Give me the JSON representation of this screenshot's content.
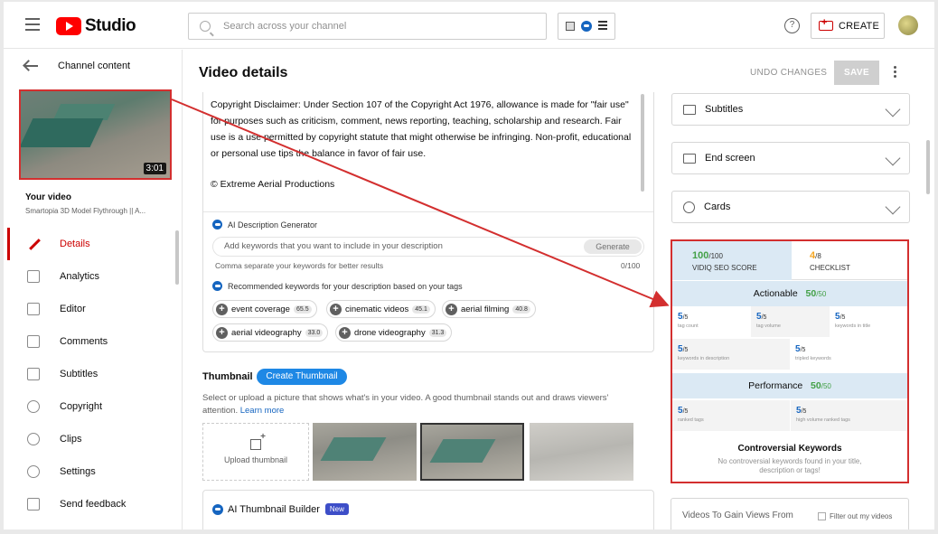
{
  "header": {
    "logo_text": "Studio",
    "search_placeholder": "Search across your channel",
    "create_label": "CREATE",
    "help_glyph": "?"
  },
  "sidebar": {
    "back_label": "Channel content",
    "video_duration": "3:01",
    "your_video_label": "Your video",
    "video_title": "Smartopia 3D Model Flythrough || A...",
    "items": [
      {
        "label": "Details",
        "icon": "pencil-icon",
        "active": true
      },
      {
        "label": "Analytics",
        "icon": "analytics-icon"
      },
      {
        "label": "Editor",
        "icon": "editor-icon"
      },
      {
        "label": "Comments",
        "icon": "comments-icon"
      },
      {
        "label": "Subtitles",
        "icon": "subtitles-icon"
      },
      {
        "label": "Copyright",
        "icon": "copyright-icon"
      },
      {
        "label": "Clips",
        "icon": "scissors-icon"
      },
      {
        "label": "Settings",
        "icon": "gear-icon"
      },
      {
        "label": "Send feedback",
        "icon": "feedback-icon"
      }
    ]
  },
  "main": {
    "title": "Video details",
    "undo_label": "UNDO CHANGES",
    "save_label": "SAVE",
    "description": {
      "text": "Copyright Disclaimer: Under Section 107 of the Copyright Act 1976, allowance is made for \"fair use\" for purposes such as criticism, comment, news reporting, teaching, scholarship and research. Fair use is a use permitted by copyright statute that might otherwise be infringing. Non-profit, educational or personal use tips the balance in favor of fair use.",
      "copyright_line": "© Extreme Aerial Productions"
    },
    "ai_description": {
      "title": "AI Description Generator",
      "placeholder": "Add keywords that you want to include in your description",
      "generate_label": "Generate",
      "help_text": "Comma separate your keywords for better results",
      "count": "0/100",
      "recommended_title": "Recommended keywords for your description based on your tags",
      "chips": [
        {
          "label": "event coverage",
          "score": "65.5"
        },
        {
          "label": "cinematic videos",
          "score": "45.1"
        },
        {
          "label": "aerial filming",
          "score": "40.8"
        },
        {
          "label": "aerial videography",
          "score": "33.0"
        },
        {
          "label": "drone videography",
          "score": "31.3"
        }
      ]
    },
    "thumbnail": {
      "title": "Thumbnail",
      "create_label": "Create Thumbnail",
      "description": "Select or upload a picture that shows what's in your video. A good thumbnail stands out and draws viewers' attention.",
      "learn_more": "Learn more",
      "upload_label": "Upload thumbnail"
    },
    "ai_thumbnail": {
      "title": "AI Thumbnail Builder",
      "badge": "New"
    }
  },
  "right": {
    "cards": [
      {
        "label": "Subtitles",
        "icon": "subtitles-icon"
      },
      {
        "label": "End screen",
        "icon": "end-screen-icon"
      },
      {
        "label": "Cards",
        "icon": "info-icon"
      }
    ],
    "vidiq": {
      "seo_score": "100",
      "seo_max": "/100",
      "seo_label": "VIDIQ SEO SCORE",
      "checklist_score": "4",
      "checklist_max": "/8",
      "checklist_label": "CHECKLIST",
      "actionable_label": "Actionable",
      "actionable_score": "50",
      "actionable_max": "/50",
      "actionable_cells": [
        {
          "value": "5",
          "max": "/5",
          "label": "tag count"
        },
        {
          "value": "5",
          "max": "/5",
          "label": "tag volume"
        },
        {
          "value": "5",
          "max": "/5",
          "label": "keywords in title"
        },
        {
          "value": "5",
          "max": "/5",
          "label": "keywords in description"
        },
        {
          "value": "5",
          "max": "/5",
          "label": "tripled keywords"
        }
      ],
      "performance_label": "Performance",
      "performance_score": "50",
      "performance_max": "/50",
      "performance_cells": [
        {
          "value": "5",
          "max": "/5",
          "label": "ranked tags"
        },
        {
          "value": "5",
          "max": "/5",
          "label": "high volume ranked tags"
        }
      ],
      "controversial_title": "Controversial Keywords",
      "controversial_desc": "No controversial keywords found in your title, description or tags!"
    },
    "gain": {
      "title": "Videos To Gain Views From",
      "filter_label": "Filter out my videos"
    }
  },
  "colors": {
    "accent_red": "#cc0000",
    "highlight_border": "#d32f2f",
    "vidiq_green": "#43a047",
    "vidiq_blue": "#1565c0",
    "checklist_orange": "#f5a623",
    "create_thumb_blue": "#1e88e5"
  }
}
